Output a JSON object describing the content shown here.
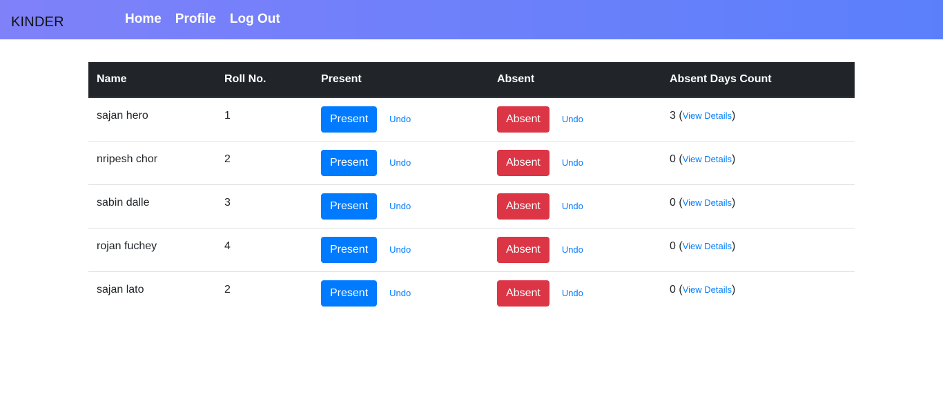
{
  "navbar": {
    "brand": "KINDER",
    "links": [
      {
        "label": "Home"
      },
      {
        "label": "Profile"
      },
      {
        "label": "Log Out"
      }
    ]
  },
  "table": {
    "headers": {
      "name": "Name",
      "roll": "Roll No.",
      "present": "Present",
      "absent": "Absent",
      "count": "Absent Days Count"
    },
    "rows": [
      {
        "name": "sajan hero",
        "roll": "1",
        "present_label": "Present",
        "present_undo": "Undo",
        "absent_label": "Absent",
        "absent_undo": "Undo",
        "count": "3",
        "details": "View Details"
      },
      {
        "name": "nripesh chor",
        "roll": "2",
        "present_label": "Present",
        "present_undo": "Undo",
        "absent_label": "Absent",
        "absent_undo": "Undo",
        "count": "0",
        "details": "View Details"
      },
      {
        "name": "sabin dalle",
        "roll": "3",
        "present_label": "Present",
        "present_undo": "Undo",
        "absent_label": "Absent",
        "absent_undo": "Undo",
        "count": "0",
        "details": "View Details"
      },
      {
        "name": "rojan fuchey",
        "roll": "4",
        "present_label": "Present",
        "present_undo": "Undo",
        "absent_label": "Absent",
        "absent_undo": "Undo",
        "count": "0",
        "details": "View Details"
      },
      {
        "name": "sajan lato",
        "roll": "2",
        "present_label": "Present",
        "present_undo": "Undo",
        "absent_label": "Absent",
        "absent_undo": "Undo",
        "count": "0",
        "details": "View Details"
      }
    ]
  },
  "colors": {
    "nav_gradient_start": "#7f81f9",
    "nav_gradient_end": "#5b7ffb",
    "table_header_bg": "#212529",
    "present_button": "#007bff",
    "absent_button": "#dc3545",
    "link": "#007bff"
  }
}
